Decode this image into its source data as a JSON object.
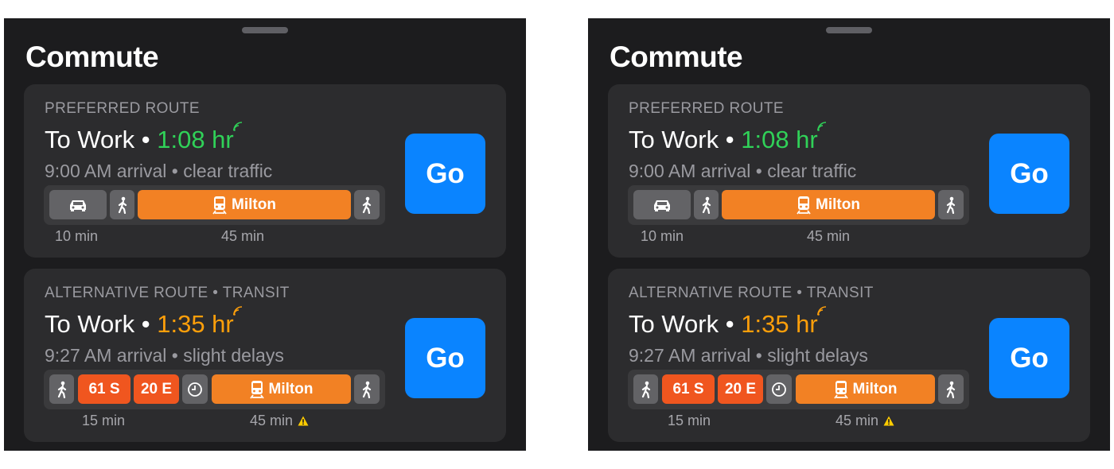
{
  "panels": [
    {
      "title": "Commute",
      "routes": [
        {
          "label": "PREFERRED ROUTE",
          "destination": "To Work",
          "separator": "•",
          "eta": "1:08 hr",
          "eta_color": "#30d158",
          "arrival": "9:00 AM arrival",
          "condition": "clear traffic",
          "segments": [
            {
              "type": "car-icon"
            },
            {
              "type": "walk-icon"
            },
            {
              "type": "train-icon",
              "label": "Milton"
            },
            {
              "type": "walk-icon"
            }
          ],
          "durations": [
            "10 min",
            "45 min"
          ],
          "go_label": "Go"
        },
        {
          "label": "ALTERNATIVE ROUTE • TRANSIT",
          "destination": "To Work",
          "separator": "•",
          "eta": "1:35 hr",
          "eta_color": "#ff9f0a",
          "arrival": "9:27 AM arrival",
          "condition": "slight delays",
          "segments": [
            {
              "type": "walk-icon"
            },
            {
              "type": "bus",
              "label": "61 S"
            },
            {
              "type": "bus",
              "label": "20 E"
            },
            {
              "type": "clock-icon"
            },
            {
              "type": "train-icon",
              "label": "Milton"
            },
            {
              "type": "walk-icon"
            }
          ],
          "durations": [
            "15 min",
            "45 min"
          ],
          "delay_icon": "warning-icon",
          "go_label": "Go"
        }
      ]
    },
    {
      "title": "Commute",
      "routes": [
        {
          "label": "PREFERRED ROUTE",
          "destination": "To Work",
          "separator": "•",
          "eta": "1:08 hr",
          "eta_color": "#30d158",
          "arrival": "9:00 AM arrival",
          "condition": "clear traffic",
          "segments": [
            {
              "type": "car-icon"
            },
            {
              "type": "walk-icon"
            },
            {
              "type": "train-icon",
              "label": "Milton"
            },
            {
              "type": "walk-icon"
            }
          ],
          "durations": [
            "10 min",
            "45 min"
          ],
          "go_label": "Go"
        },
        {
          "label": "ALTERNATIVE ROUTE • TRANSIT",
          "destination": "To Work",
          "separator": "•",
          "eta": "1:35 hr",
          "eta_color": "#ff9f0a",
          "arrival": "9:27 AM arrival",
          "condition": "slight delays",
          "segments": [
            {
              "type": "walk-icon"
            },
            {
              "type": "bus",
              "label": "61 S"
            },
            {
              "type": "bus",
              "label": "20 E"
            },
            {
              "type": "clock-icon"
            },
            {
              "type": "train-icon",
              "label": "Milton"
            },
            {
              "type": "walk-icon"
            }
          ],
          "durations": [
            "15 min",
            "45 min"
          ],
          "delay_icon": "warning-icon",
          "go_label": "Go"
        }
      ]
    }
  ]
}
